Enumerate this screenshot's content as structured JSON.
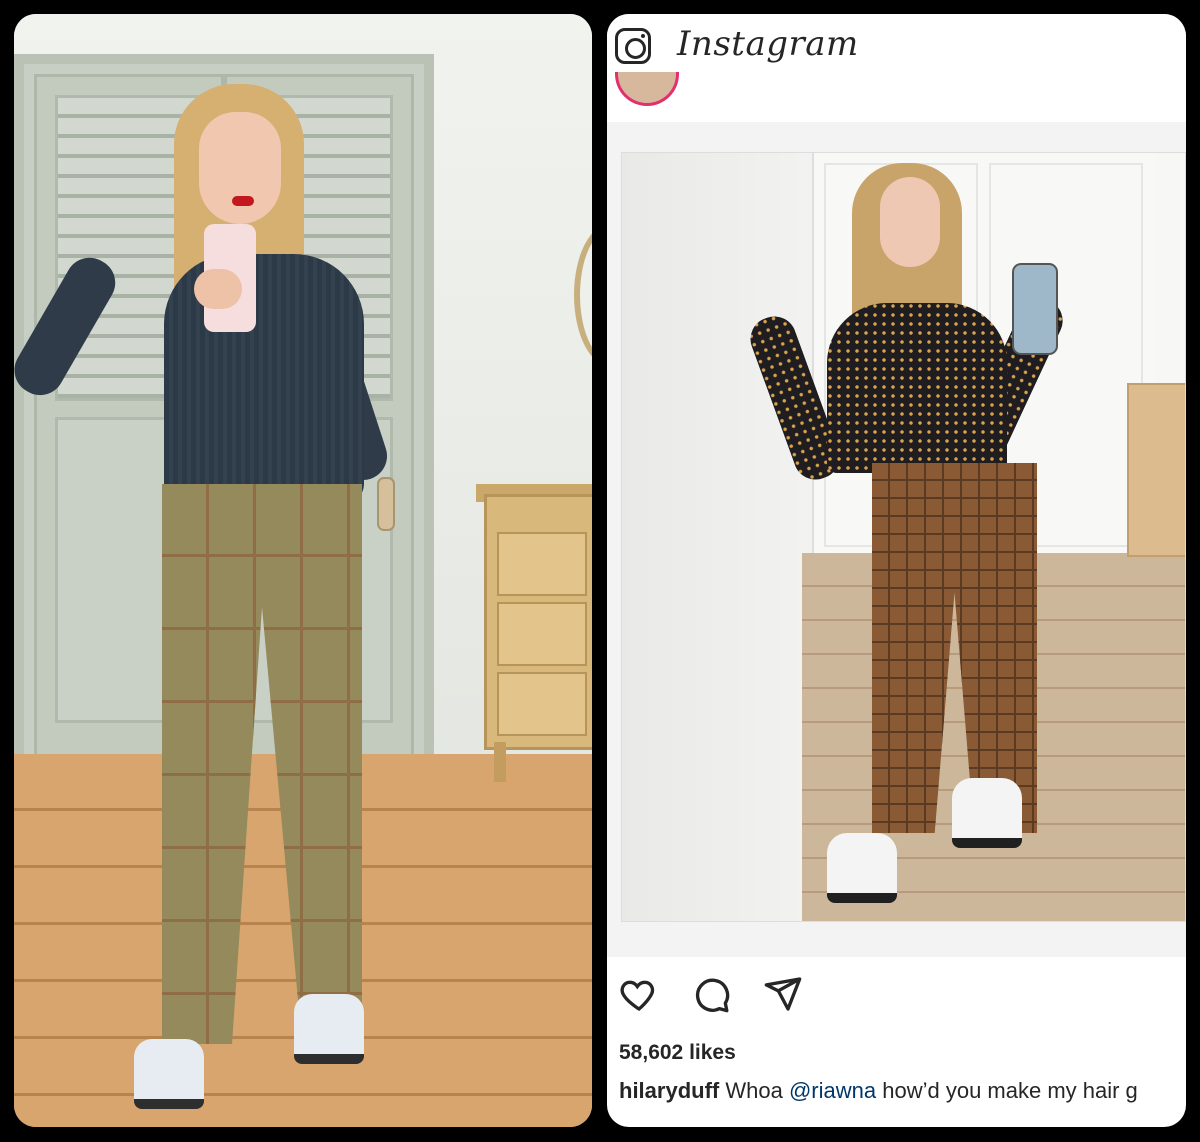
{
  "instagram": {
    "logo": "Instagram",
    "actions": {
      "like_icon": "heart-icon",
      "comment_icon": "comment-icon",
      "share_icon": "paper-plane-icon"
    },
    "likes": "58,602 likes",
    "caption": {
      "username": "hilaryduff",
      "text_before": "Whoa",
      "mention": "@riawna",
      "text_after": "how’d you make my hair g"
    }
  },
  "colors": {
    "background": "#000000",
    "ig_text": "#262626",
    "mention": "#00376b",
    "story_ring": "#e1306c"
  }
}
